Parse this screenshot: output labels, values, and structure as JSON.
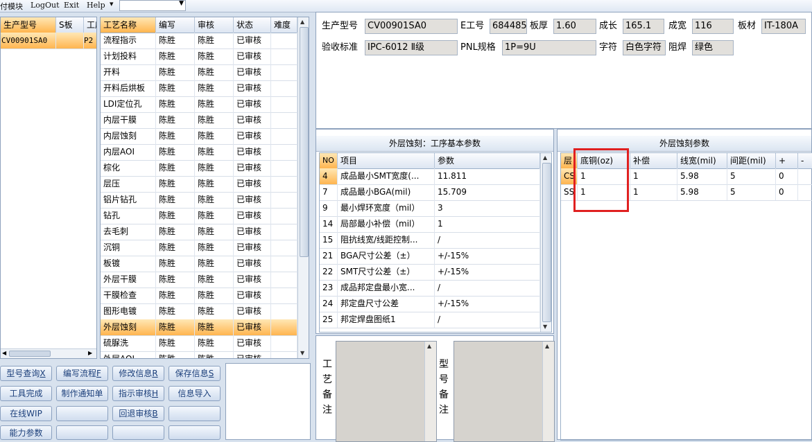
{
  "menu": {
    "items": [
      "付模块",
      "LogOut",
      "Exit",
      "Help"
    ]
  },
  "left_grid": {
    "columns": [
      "生产型号",
      "S板",
      "工序"
    ],
    "rows": [
      {
        "model": "CV00901SA0",
        "s": "",
        "p": "P2"
      }
    ]
  },
  "process_grid": {
    "columns": [
      "工艺名称",
      "编写",
      "审核",
      "状态",
      "难度"
    ],
    "rows": [
      {
        "name": "流程指示",
        "writer": "陈胜",
        "checker": "陈胜",
        "status": "已审核"
      },
      {
        "name": "计划投料",
        "writer": "陈胜",
        "checker": "陈胜",
        "status": "已审核"
      },
      {
        "name": "开料",
        "writer": "陈胜",
        "checker": "陈胜",
        "status": "已审核"
      },
      {
        "name": "开料后烘板",
        "writer": "陈胜",
        "checker": "陈胜",
        "status": "已审核"
      },
      {
        "name": "LDI定位孔",
        "writer": "陈胜",
        "checker": "陈胜",
        "status": "已审核"
      },
      {
        "name": "内层干膜",
        "writer": "陈胜",
        "checker": "陈胜",
        "status": "已审核"
      },
      {
        "name": "内层蚀刻",
        "writer": "陈胜",
        "checker": "陈胜",
        "status": "已审核"
      },
      {
        "name": "内层AOI",
        "writer": "陈胜",
        "checker": "陈胜",
        "status": "已审核"
      },
      {
        "name": "棕化",
        "writer": "陈胜",
        "checker": "陈胜",
        "status": "已审核"
      },
      {
        "name": "层压",
        "writer": "陈胜",
        "checker": "陈胜",
        "status": "已审核"
      },
      {
        "name": "铝片钻孔",
        "writer": "陈胜",
        "checker": "陈胜",
        "status": "已审核"
      },
      {
        "name": "钻孔",
        "writer": "陈胜",
        "checker": "陈胜",
        "status": "已审核"
      },
      {
        "name": "去毛刺",
        "writer": "陈胜",
        "checker": "陈胜",
        "status": "已审核"
      },
      {
        "name": "沉铜",
        "writer": "陈胜",
        "checker": "陈胜",
        "status": "已审核"
      },
      {
        "name": "板镀",
        "writer": "陈胜",
        "checker": "陈胜",
        "status": "已审核"
      },
      {
        "name": "外层干膜",
        "writer": "陈胜",
        "checker": "陈胜",
        "status": "已审核"
      },
      {
        "name": "干膜检查",
        "writer": "陈胜",
        "checker": "陈胜",
        "status": "已审核"
      },
      {
        "name": "图形电镀",
        "writer": "陈胜",
        "checker": "陈胜",
        "status": "已审核"
      },
      {
        "name": "外层蚀刻",
        "writer": "陈胜",
        "checker": "陈胜",
        "status": "已审核"
      },
      {
        "name": "硫脲洗",
        "writer": "陈胜",
        "checker": "陈胜",
        "status": "已审核"
      },
      {
        "name": "外层AOI",
        "writer": "陈胜",
        "checker": "陈胜",
        "status": "已审核"
      }
    ]
  },
  "buttons": {
    "r1": [
      "型号查询",
      "编写流程",
      "修改信息",
      "保存信息"
    ],
    "r1_keys": [
      "X",
      "F",
      "R",
      "S"
    ],
    "r2": [
      "工具完成",
      "制作通知单",
      "指示审核",
      "信息导入"
    ],
    "r2_key3": "H",
    "r3_1": "在线WIP",
    "r3_3": "回退审核",
    "r3_3_key": "B",
    "r4_1": "能力参数"
  },
  "info": {
    "model_label": "生产型号",
    "model": "CV00901SA0",
    "eno_label": "E工号",
    "eno": "684485",
    "thick_label": "板厚",
    "thick": "1.60",
    "length_label": "成长",
    "length": "165.1",
    "width_label": "成宽",
    "width": "116",
    "material_label": "板材",
    "material": "IT-180A",
    "std_label": "验收标准",
    "std": "IPC-6012 Ⅱ级",
    "pnl_label": "PNL规格",
    "pnl": "1P=9U",
    "char_label": "字符",
    "char": "白色字符",
    "mask_label": "阻焊",
    "mask": "绿色"
  },
  "params": {
    "title": "外层蚀刻：工序基本参数",
    "columns": [
      "NO",
      "项目",
      "参数"
    ],
    "rows": [
      {
        "no": "4",
        "item": "成品最小SMT宽度(...",
        "value": "11.811"
      },
      {
        "no": "7",
        "item": "成品最小BGA(mil)",
        "value": "15.709"
      },
      {
        "no": "9",
        "item": "最小焊环宽度（mil）",
        "value": "3"
      },
      {
        "no": "14",
        "item": "局部最小补偿（mil）",
        "value": "1"
      },
      {
        "no": "15",
        "item": "阻抗线宽/线距控制...",
        "value": "/"
      },
      {
        "no": "21",
        "item": "BGA尺寸公差（±）",
        "value": "+/-15%"
      },
      {
        "no": "22",
        "item": "SMT尺寸公差（±）",
        "value": "+/-15%"
      },
      {
        "no": "23",
        "item": "成品邦定盘最小宽...",
        "value": "/"
      },
      {
        "no": "24",
        "item": "邦定盘尺寸公差",
        "value": "+/-15%"
      },
      {
        "no": "25",
        "item": "邦定焊盘图纸1",
        "value": "/"
      }
    ]
  },
  "etch": {
    "title": "外层蚀刻参数",
    "columns": [
      "层",
      "底铜(oz)",
      "补偿",
      "线宽(mil)",
      "间距(mil)",
      "+",
      "-"
    ],
    "rows": [
      {
        "layer": "CS",
        "cu": "1",
        "comp": "1",
        "lw": "5.98",
        "sp": "5",
        "plus": "0",
        "minus": ""
      },
      {
        "layer": "SS",
        "cu": "1",
        "comp": "1",
        "lw": "5.98",
        "sp": "5",
        "plus": "0",
        "minus": ""
      }
    ]
  },
  "memo": {
    "process_label": "工艺备注",
    "model_label": "型号备注"
  },
  "colors": {
    "highlight_box": "#e02020",
    "selected_row": "#ffb54f"
  }
}
